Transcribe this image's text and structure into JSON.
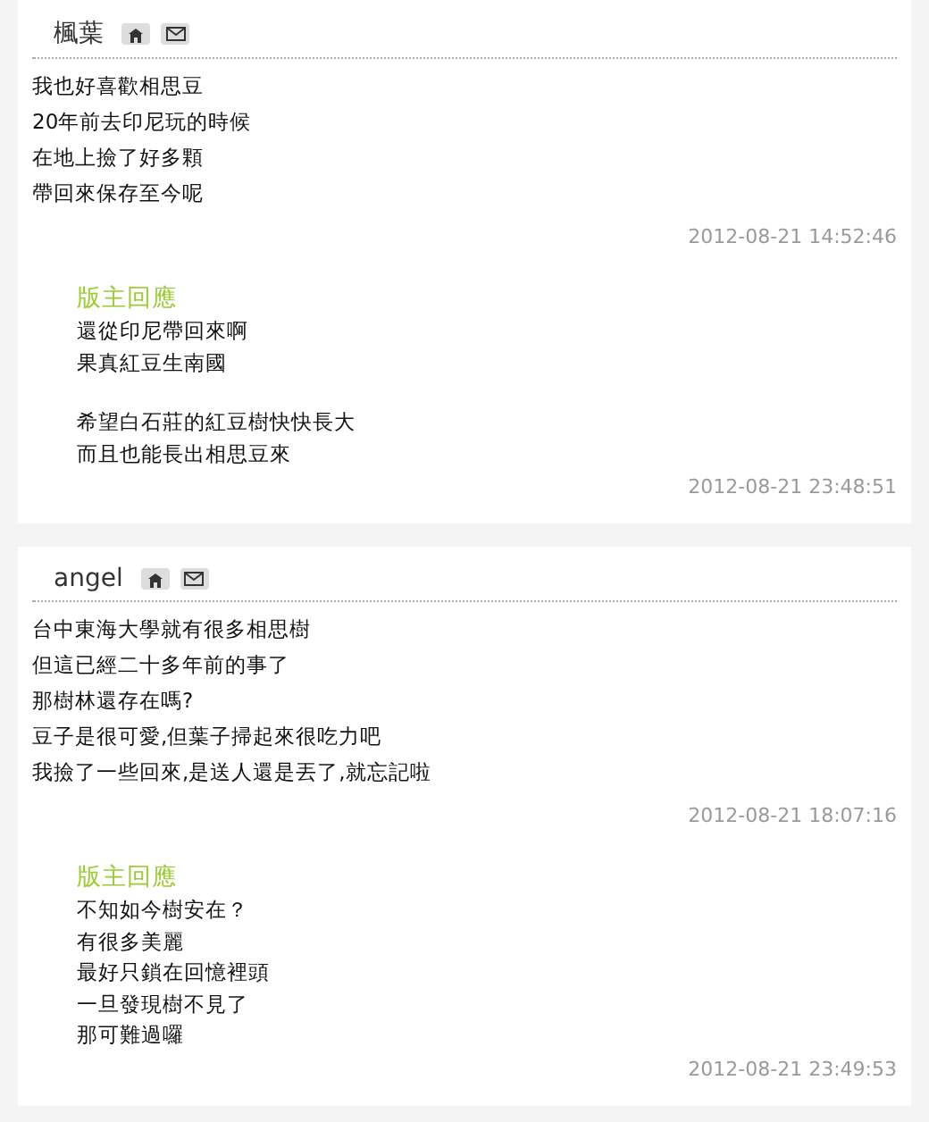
{
  "comments": [
    {
      "author": "楓葉",
      "lines": [
        "我也好喜歡相思豆",
        "20年前去印尼玩的時候",
        "在地上撿了好多顆",
        "帶回來保存至今呢"
      ],
      "time": "2012-08-21 14:52:46",
      "reply": {
        "title": "版主回應",
        "paragraphs": [
          [
            "還從印尼帶回來啊",
            "果真紅豆生南國"
          ],
          [
            "希望白石莊的紅豆樹快快長大",
            "而且也能長出相思豆來"
          ]
        ],
        "time": "2012-08-21 23:48:51"
      }
    },
    {
      "author": "angel",
      "lines": [
        "台中東海大學就有很多相思樹",
        "但這已經二十多年前的事了",
        "那樹林還存在嗎?",
        "豆子是很可愛,但葉子掃起來很吃力吧",
        "我撿了一些回來,是送人還是丟了,就忘記啦"
      ],
      "time": "2012-08-21 18:07:16",
      "reply": {
        "title": "版主回應",
        "paragraphs": [
          [
            "不知如今樹安在？",
            "有很多美麗",
            "最好只鎖在回憶裡頭",
            "一旦發現樹不見了",
            "那可難過囉"
          ]
        ],
        "time": "2012-08-21 23:49:53"
      }
    }
  ]
}
